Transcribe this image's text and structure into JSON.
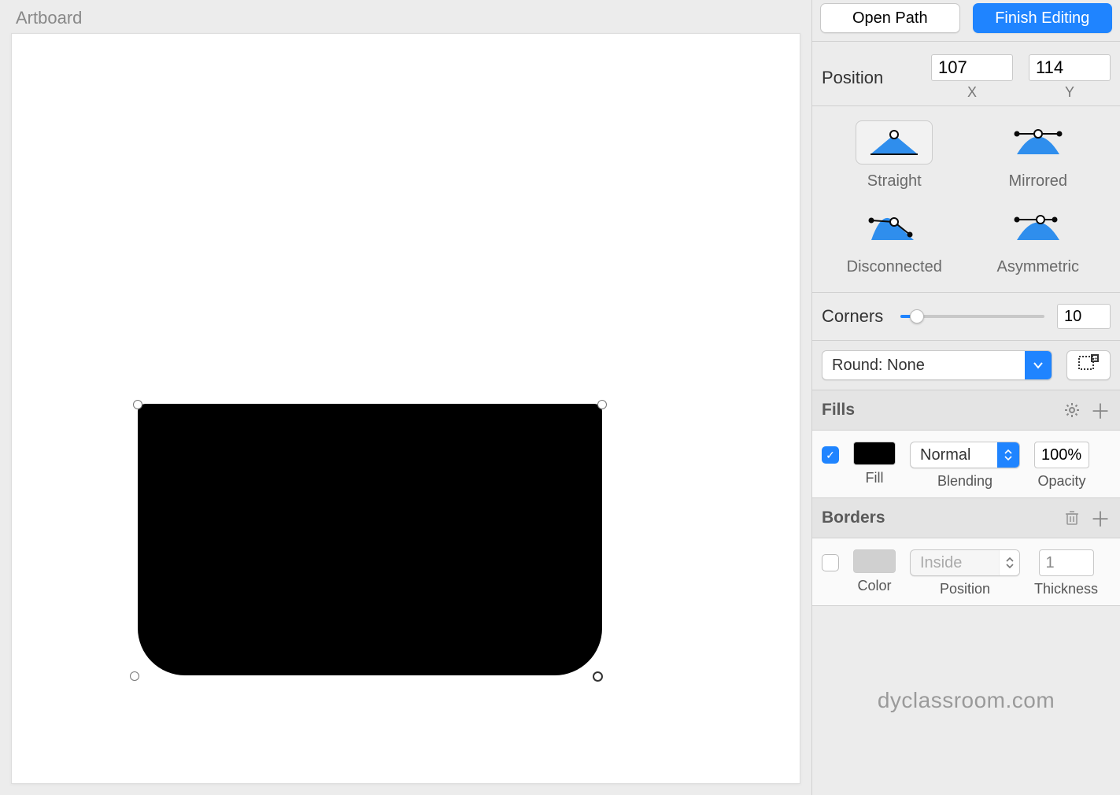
{
  "canvas": {
    "artboard_label": "Artboard"
  },
  "toolbar": {
    "open_path": "Open Path",
    "finish_editing": "Finish Editing"
  },
  "position": {
    "label": "Position",
    "x_value": "107",
    "x_label": "X",
    "y_value": "114",
    "y_label": "Y"
  },
  "point_types": {
    "straight": "Straight",
    "mirrored": "Mirrored",
    "disconnected": "Disconnected",
    "asymmetric": "Asymmetric"
  },
  "corners": {
    "label": "Corners",
    "value": "10"
  },
  "round": {
    "selected": "Round: None"
  },
  "fills": {
    "title": "Fills",
    "fill_label": "Fill",
    "blending_label": "Blending",
    "blending_value": "Normal",
    "opacity_label": "Opacity",
    "opacity_value": "100%"
  },
  "borders": {
    "title": "Borders",
    "color_label": "Color",
    "position_label": "Position",
    "position_value": "Inside",
    "thickness_label": "Thickness",
    "thickness_value": "1"
  },
  "watermark": "dyclassroom.com"
}
